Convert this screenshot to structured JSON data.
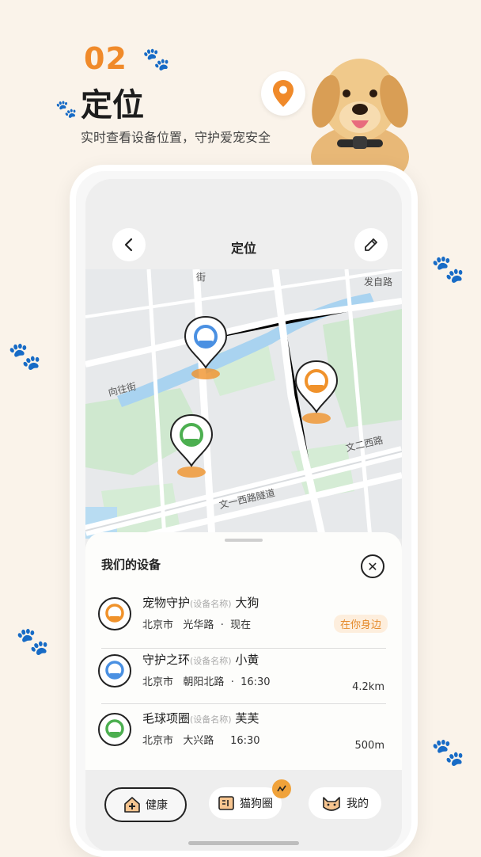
{
  "headline": {
    "number": "02",
    "title": "定位",
    "subtitle": "实时查看设备位置，守护爱宠安全"
  },
  "app": {
    "title": "定位",
    "back_icon": "chevron-left-icon",
    "edit_icon": "edit-icon"
  },
  "map": {
    "street_labels": [
      "向往街",
      "文一西路隧道",
      "文二西路",
      "发自路",
      "街"
    ],
    "markers": [
      {
        "device": "守护之环",
        "color": "#4a90e2"
      },
      {
        "device": "宠物守护",
        "color": "#f0922b"
      },
      {
        "device": "毛球项圈",
        "color": "#4caf50"
      }
    ]
  },
  "sheet": {
    "title": "我们的设备",
    "close_icon": "close-icon",
    "devices": [
      {
        "name": "宠物守护",
        "tag": "(设备名称)",
        "pet": "大狗",
        "city": "北京市",
        "street": "光华路",
        "sep": "·",
        "time": "现在",
        "distance": "",
        "status": "在你身边",
        "color": "#f0922b"
      },
      {
        "name": "守护之环",
        "tag": "(设备名称)",
        "pet": "小黄",
        "city": "北京市",
        "street": "朝阳北路",
        "sep": "·",
        "time": "16:30",
        "distance": "4.2km",
        "status": "",
        "color": "#4a90e2"
      },
      {
        "name": "毛球项圈",
        "tag": "(设备名称)",
        "pet": "芙芙",
        "city": "北京市",
        "street": "大兴路",
        "sep": "",
        "time": "16:30",
        "distance": "500m",
        "status": "",
        "color": "#4caf50"
      }
    ]
  },
  "tabs": [
    {
      "label": "健康",
      "icon": "health-house-icon",
      "active": true
    },
    {
      "label": "猫狗圈",
      "icon": "community-icon",
      "active": false
    },
    {
      "label": "我的",
      "icon": "cat-face-icon",
      "active": false
    }
  ],
  "colors": {
    "accent": "#f08a2a",
    "background": "#faf3ea"
  }
}
